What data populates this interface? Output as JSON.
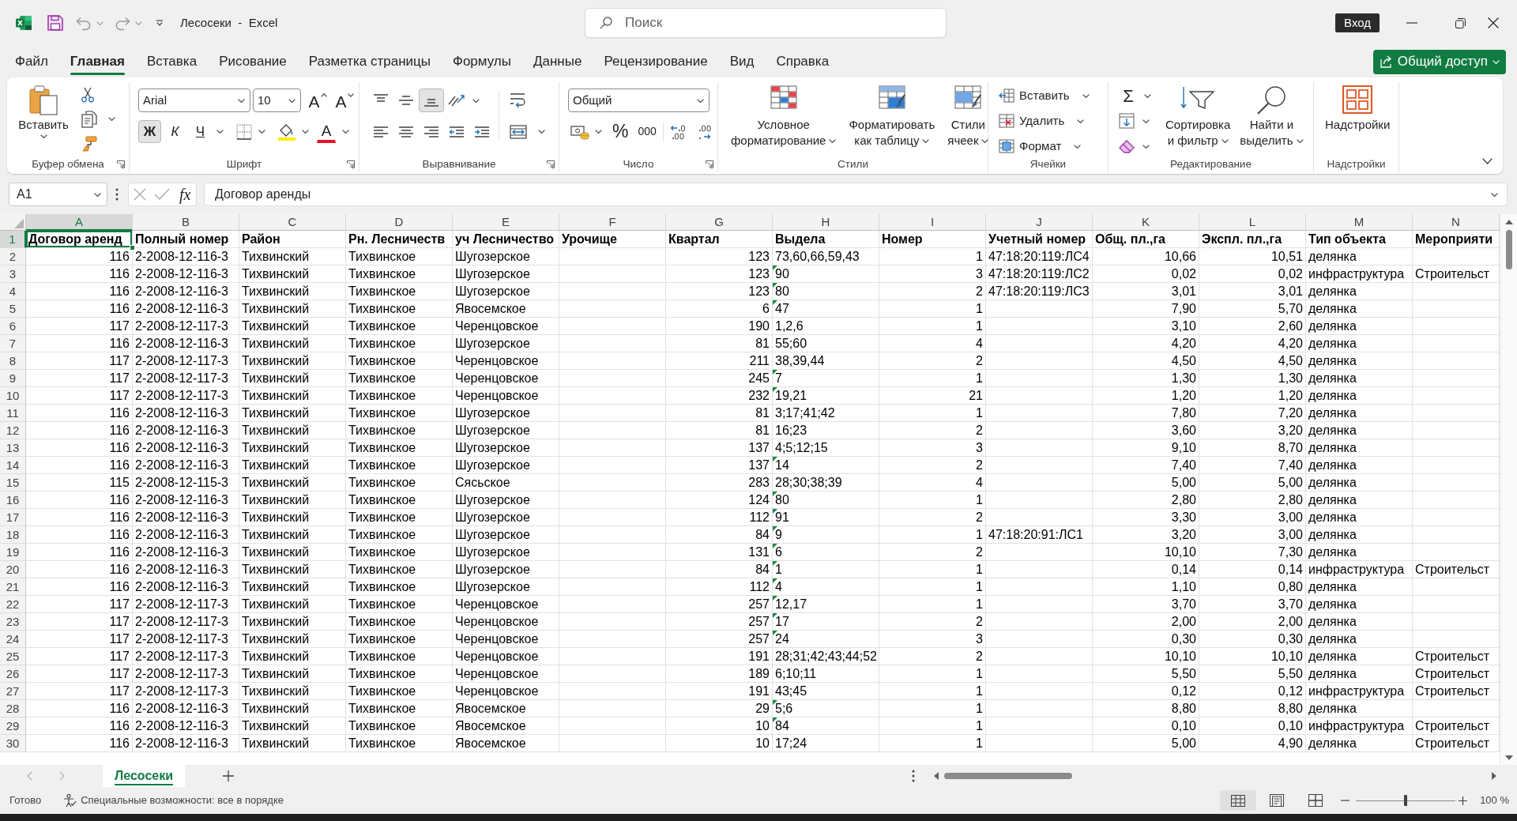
{
  "title_bar": {
    "title": "Лесосеки  -  Excel",
    "search": {
      "placeholder": "Поиск"
    },
    "sign_in": "Вход"
  },
  "ribbon_tabs": [
    {
      "label": "Файл",
      "selected": false
    },
    {
      "label": "Главная",
      "selected": true
    },
    {
      "label": "Вставка",
      "selected": false
    },
    {
      "label": "Рисование",
      "selected": false
    },
    {
      "label": "Разметка страницы",
      "selected": false
    },
    {
      "label": "Формулы",
      "selected": false
    },
    {
      "label": "Данные",
      "selected": false
    },
    {
      "label": "Рецензирование",
      "selected": false
    },
    {
      "label": "Вид",
      "selected": false
    },
    {
      "label": "Справка",
      "selected": false
    }
  ],
  "share_button": "Общий доступ",
  "ribbon_groups": [
    {
      "kind": "clipboard",
      "label": "Буфер обмена",
      "paste": "Вставить"
    },
    {
      "kind": "font",
      "label": "Шрифт",
      "font_name": "Arial",
      "font_size": "10",
      "grow_font": "A",
      "shrink_font": "A",
      "font_color": "A",
      "style_buttons": [
        {
          "kind": "bold",
          "label": "Ж",
          "pressed": true
        },
        {
          "kind": "italic",
          "label": "К",
          "pressed": false
        },
        {
          "kind": "underline",
          "label": "Ч",
          "pressed": false
        }
      ]
    },
    {
      "kind": "alignment",
      "label": "Выравнивание",
      "vertical_align": [
        {
          "kind": "top",
          "pressed": false
        },
        {
          "kind": "middle",
          "pressed": false
        },
        {
          "kind": "bottom",
          "pressed": true
        }
      ]
    },
    {
      "kind": "number",
      "label": "Число",
      "format": "Общий",
      "percent": "%",
      "thousands": "000"
    },
    {
      "kind": "styles",
      "label": "Стили",
      "buttons": [
        {
          "kind": "conditional",
          "lines": [
            "Условное",
            "форматирование"
          ]
        },
        {
          "kind": "table",
          "lines": [
            "Форматировать",
            "как таблицу"
          ]
        },
        {
          "kind": "cell_styles",
          "lines": [
            "Стили",
            "ячеек"
          ]
        }
      ]
    },
    {
      "kind": "cells",
      "label": "Ячейки",
      "buttons": [
        {
          "kind": "insert",
          "label": "Вставить"
        },
        {
          "kind": "delete",
          "label": "Удалить"
        },
        {
          "kind": "format",
          "label": "Формат"
        }
      ]
    },
    {
      "kind": "editing",
      "label": "Редактирование",
      "autosum": "Σ",
      "buttons": [
        {
          "kind": "sort",
          "lines": [
            "Сортировка",
            "и фильтр"
          ]
        },
        {
          "kind": "find",
          "lines": [
            "Найти и",
            "выделить"
          ]
        }
      ]
    },
    {
      "kind": "addins",
      "label": "Надстройки",
      "button": "Надстройки"
    }
  ],
  "formula_bar": {
    "name_box": "A1",
    "function_button": "fx",
    "formula": "Договор аренды"
  },
  "sheet": {
    "columns": [
      {
        "letter": "A",
        "kind": "number",
        "selected": true
      },
      {
        "letter": "B",
        "kind": "text",
        "selected": false
      },
      {
        "letter": "C",
        "kind": "text",
        "selected": false
      },
      {
        "letter": "D",
        "kind": "text",
        "selected": false
      },
      {
        "letter": "E",
        "kind": "text",
        "selected": false
      },
      {
        "letter": "F",
        "selected": false
      },
      {
        "letter": "G",
        "kind": "number",
        "selected": false
      },
      {
        "letter": "H",
        "kind": "text_number",
        "selected": false
      },
      {
        "letter": "I",
        "kind": "number",
        "selected": false
      },
      {
        "letter": "J",
        "kind": "text",
        "selected": false
      },
      {
        "letter": "K",
        "kind": "number",
        "selected": false
      },
      {
        "letter": "L",
        "kind": "number",
        "selected": false
      },
      {
        "letter": "M",
        "kind": "text",
        "selected": false
      },
      {
        "letter": "N",
        "kind": "text",
        "selected": false
      }
    ],
    "header_row": {
      "number": "1",
      "selected": true,
      "cells": {
        "A": "Договор аренд",
        "B": "Полный номер",
        "C": "Район",
        "D": "Рн. Лесничеств",
        "E": "уч Лесничество",
        "F": "Урочище",
        "G": "Квартал",
        "H": "Выдела",
        "I": "Номер",
        "J": "Учетный номер",
        "K": "Общ. пл.,га",
        "L": "Экспл. пл.,га",
        "M": "Тип объекта",
        "N": "Мероприяти"
      }
    },
    "rows": [
      {
        "number": "2",
        "selected": false,
        "text_number_flag": false,
        "cells": {
          "A": "116",
          "B": "2-2008-12-116-3",
          "C": "Тихвинский",
          "D": "Тихвинское",
          "E": "Шугозерское",
          "G": "123",
          "H": "73,60,66,59,43",
          "I": "1",
          "J": "47:18:20:119:ЛС4",
          "K": "10,66",
          "L": "10,51",
          "M": "делянка"
        }
      },
      {
        "number": "3",
        "selected": false,
        "text_number_flag": true,
        "cells": {
          "A": "116",
          "B": "2-2008-12-116-3",
          "C": "Тихвинский",
          "D": "Тихвинское",
          "E": "Шугозерское",
          "G": "123",
          "H": "90",
          "I": "3",
          "J": "47:18:20:119:ЛС2",
          "K": "0,02",
          "L": "0,02",
          "M": "инфраструктура",
          "N": "Строительст"
        }
      },
      {
        "number": "4",
        "selected": false,
        "text_number_flag": true,
        "cells": {
          "A": "116",
          "B": "2-2008-12-116-3",
          "C": "Тихвинский",
          "D": "Тихвинское",
          "E": "Шугозерское",
          "G": "123",
          "H": "80",
          "I": "2",
          "J": "47:18:20:119:ЛС3",
          "K": "3,01",
          "L": "3,01",
          "M": "делянка"
        }
      },
      {
        "number": "5",
        "selected": false,
        "text_number_flag": true,
        "cells": {
          "A": "116",
          "B": "2-2008-12-116-3",
          "C": "Тихвинский",
          "D": "Тихвинское",
          "E": "Явосемское",
          "G": "6",
          "H": "47",
          "I": "1",
          "K": "7,90",
          "L": "5,70",
          "M": "делянка"
        }
      },
      {
        "number": "6",
        "selected": false,
        "text_number_flag": false,
        "cells": {
          "A": "117",
          "B": "2-2008-12-117-3",
          "C": "Тихвинский",
          "D": "Тихвинское",
          "E": "Черенцовское",
          "G": "190",
          "H": "1,2,6",
          "I": "1",
          "K": "3,10",
          "L": "2,60",
          "M": "делянка"
        }
      },
      {
        "number": "7",
        "selected": false,
        "text_number_flag": false,
        "cells": {
          "A": "116",
          "B": "2-2008-12-116-3",
          "C": "Тихвинский",
          "D": "Тихвинское",
          "E": "Шугозерское",
          "G": "81",
          "H": "55;60",
          "I": "4",
          "K": "4,20",
          "L": "4,20",
          "M": "делянка"
        }
      },
      {
        "number": "8",
        "selected": false,
        "text_number_flag": false,
        "cells": {
          "A": "117",
          "B": "2-2008-12-117-3",
          "C": "Тихвинский",
          "D": "Тихвинское",
          "E": "Черенцовское",
          "G": "211",
          "H": "38,39,44",
          "I": "2",
          "K": "4,50",
          "L": "4,50",
          "M": "делянка"
        }
      },
      {
        "number": "9",
        "selected": false,
        "text_number_flag": true,
        "cells": {
          "A": "117",
          "B": "2-2008-12-117-3",
          "C": "Тихвинский",
          "D": "Тихвинское",
          "E": "Черенцовское",
          "G": "245",
          "H": "7",
          "I": "1",
          "K": "1,30",
          "L": "1,30",
          "M": "делянка"
        }
      },
      {
        "number": "10",
        "selected": false,
        "text_number_flag": true,
        "cells": {
          "A": "117",
          "B": "2-2008-12-117-3",
          "C": "Тихвинский",
          "D": "Тихвинское",
          "E": "Черенцовское",
          "G": "232",
          "H": "19,21",
          "I": "21",
          "K": "1,20",
          "L": "1,20",
          "M": "делянка"
        }
      },
      {
        "number": "11",
        "selected": false,
        "text_number_flag": false,
        "cells": {
          "A": "116",
          "B": "2-2008-12-116-3",
          "C": "Тихвинский",
          "D": "Тихвинское",
          "E": "Шугозерское",
          "G": "81",
          "H": "3;17;41;42",
          "I": "1",
          "K": "7,80",
          "L": "7,20",
          "M": "делянка"
        }
      },
      {
        "number": "12",
        "selected": false,
        "text_number_flag": false,
        "cells": {
          "A": "116",
          "B": "2-2008-12-116-3",
          "C": "Тихвинский",
          "D": "Тихвинское",
          "E": "Шугозерское",
          "G": "81",
          "H": "16;23",
          "I": "2",
          "K": "3,60",
          "L": "3,20",
          "M": "делянка"
        }
      },
      {
        "number": "13",
        "selected": false,
        "text_number_flag": false,
        "cells": {
          "A": "116",
          "B": "2-2008-12-116-3",
          "C": "Тихвинский",
          "D": "Тихвинское",
          "E": "Шугозерское",
          "G": "137",
          "H": "4;5;12;15",
          "I": "3",
          "K": "9,10",
          "L": "8,70",
          "M": "делянка"
        }
      },
      {
        "number": "14",
        "selected": false,
        "text_number_flag": true,
        "cells": {
          "A": "116",
          "B": "2-2008-12-116-3",
          "C": "Тихвинский",
          "D": "Тихвинское",
          "E": "Шугозерское",
          "G": "137",
          "H": "14",
          "I": "2",
          "K": "7,40",
          "L": "7,40",
          "M": "делянка"
        }
      },
      {
        "number": "15",
        "selected": false,
        "text_number_flag": false,
        "cells": {
          "A": "115",
          "B": "2-2008-12-115-3",
          "C": "Тихвинский",
          "D": "Тихвинское",
          "E": "Сясьское",
          "G": "283",
          "H": "28;30;38;39",
          "I": "4",
          "K": "5,00",
          "L": "5,00",
          "M": "делянка"
        }
      },
      {
        "number": "16",
        "selected": false,
        "text_number_flag": true,
        "cells": {
          "A": "116",
          "B": "2-2008-12-116-3",
          "C": "Тихвинский",
          "D": "Тихвинское",
          "E": "Шугозерское",
          "G": "124",
          "H": "80",
          "I": "1",
          "K": "2,80",
          "L": "2,80",
          "M": "делянка"
        }
      },
      {
        "number": "17",
        "selected": false,
        "text_number_flag": true,
        "cells": {
          "A": "116",
          "B": "2-2008-12-116-3",
          "C": "Тихвинский",
          "D": "Тихвинское",
          "E": "Шугозерское",
          "G": "112",
          "H": "91",
          "I": "2",
          "K": "3,30",
          "L": "3,00",
          "M": "делянка"
        }
      },
      {
        "number": "18",
        "selected": false,
        "text_number_flag": true,
        "cells": {
          "A": "116",
          "B": "2-2008-12-116-3",
          "C": "Тихвинский",
          "D": "Тихвинское",
          "E": "Шугозерское",
          "G": "84",
          "H": "9",
          "I": "1",
          "J": "47:18:20:91:ЛС1",
          "K": "3,20",
          "L": "3,00",
          "M": "делянка"
        }
      },
      {
        "number": "19",
        "selected": false,
        "text_number_flag": true,
        "cells": {
          "A": "116",
          "B": "2-2008-12-116-3",
          "C": "Тихвинский",
          "D": "Тихвинское",
          "E": "Шугозерское",
          "G": "131",
          "H": "6",
          "I": "2",
          "K": "10,10",
          "L": "7,30",
          "M": "делянка"
        }
      },
      {
        "number": "20",
        "selected": false,
        "text_number_flag": true,
        "cells": {
          "A": "116",
          "B": "2-2008-12-116-3",
          "C": "Тихвинский",
          "D": "Тихвинское",
          "E": "Шугозерское",
          "G": "84",
          "H": "1",
          "I": "1",
          "K": "0,14",
          "L": "0,14",
          "M": "инфраструктура",
          "N": "Строительст"
        }
      },
      {
        "number": "21",
        "selected": false,
        "text_number_flag": true,
        "cells": {
          "A": "116",
          "B": "2-2008-12-116-3",
          "C": "Тихвинский",
          "D": "Тихвинское",
          "E": "Шугозерское",
          "G": "112",
          "H": "4",
          "I": "1",
          "K": "1,10",
          "L": "0,80",
          "M": "делянка"
        }
      },
      {
        "number": "22",
        "selected": false,
        "text_number_flag": true,
        "cells": {
          "A": "117",
          "B": "2-2008-12-117-3",
          "C": "Тихвинский",
          "D": "Тихвинское",
          "E": "Черенцовское",
          "G": "257",
          "H": "12,17",
          "I": "1",
          "K": "3,70",
          "L": "3,70",
          "M": "делянка"
        }
      },
      {
        "number": "23",
        "selected": false,
        "text_number_flag": true,
        "cells": {
          "A": "117",
          "B": "2-2008-12-117-3",
          "C": "Тихвинский",
          "D": "Тихвинское",
          "E": "Черенцовское",
          "G": "257",
          "H": "17",
          "I": "2",
          "K": "2,00",
          "L": "2,00",
          "M": "делянка"
        }
      },
      {
        "number": "24",
        "selected": false,
        "text_number_flag": true,
        "cells": {
          "A": "117",
          "B": "2-2008-12-117-3",
          "C": "Тихвинский",
          "D": "Тихвинское",
          "E": "Черенцовское",
          "G": "257",
          "H": "24",
          "I": "3",
          "K": "0,30",
          "L": "0,30",
          "M": "делянка"
        }
      },
      {
        "number": "25",
        "selected": false,
        "text_number_flag": false,
        "cells": {
          "A": "117",
          "B": "2-2008-12-117-3",
          "C": "Тихвинский",
          "D": "Тихвинское",
          "E": "Черенцовское",
          "G": "191",
          "H": "28;31;42;43;44;52",
          "I": "2",
          "K": "10,10",
          "L": "10,10",
          "M": "делянка",
          "N": "Строительст"
        }
      },
      {
        "number": "26",
        "selected": false,
        "text_number_flag": false,
        "cells": {
          "A": "117",
          "B": "2-2008-12-117-3",
          "C": "Тихвинский",
          "D": "Тихвинское",
          "E": "Черенцовское",
          "G": "189",
          "H": "6;10;11",
          "I": "1",
          "K": "5,50",
          "L": "5,50",
          "M": "делянка",
          "N": "Строительст"
        }
      },
      {
        "number": "27",
        "selected": false,
        "text_number_flag": false,
        "cells": {
          "A": "117",
          "B": "2-2008-12-117-3",
          "C": "Тихвинский",
          "D": "Тихвинское",
          "E": "Черенцовское",
          "G": "191",
          "H": "43;45",
          "I": "1",
          "K": "0,12",
          "L": "0,12",
          "M": "инфраструктура",
          "N": "Строительст"
        }
      },
      {
        "number": "28",
        "selected": false,
        "text_number_flag": true,
        "cells": {
          "A": "116",
          "B": "2-2008-12-116-3",
          "C": "Тихвинский",
          "D": "Тихвинское",
          "E": "Явосемское",
          "G": "29",
          "H": "5;6",
          "I": "1",
          "K": "8,80",
          "L": "8,80",
          "M": "делянка"
        }
      },
      {
        "number": "29",
        "selected": false,
        "text_number_flag": true,
        "cells": {
          "A": "116",
          "B": "2-2008-12-116-3",
          "C": "Тихвинский",
          "D": "Тихвинское",
          "E": "Явосемское",
          "G": "10",
          "H": "84",
          "I": "1",
          "K": "0,10",
          "L": "0,10",
          "M": "инфраструктура",
          "N": "Строительст"
        }
      },
      {
        "number": "30",
        "selected": false,
        "text_number_flag": false,
        "cells": {
          "A": "116",
          "B": "2-2008-12-116-3",
          "C": "Тихвинский",
          "D": "Тихвинское",
          "E": "Явосемское",
          "G": "10",
          "H": "17;24",
          "I": "1",
          "K": "5,00",
          "L": "4,90",
          "M": "делянка",
          "N": "Строительст"
        }
      }
    ]
  },
  "sheet_tabs": [
    {
      "label": "Лесосеки",
      "selected": true
    }
  ],
  "status_bar": {
    "ready": "Готово",
    "accessibility": "Специальные возможности: все в порядке",
    "views": [
      {
        "kind": "normal",
        "selected": true
      },
      {
        "kind": "page_layout",
        "selected": false
      },
      {
        "kind": "page_break",
        "selected": false
      }
    ],
    "zoom": {
      "level": 0.5,
      "reading": "100 %"
    }
  }
}
